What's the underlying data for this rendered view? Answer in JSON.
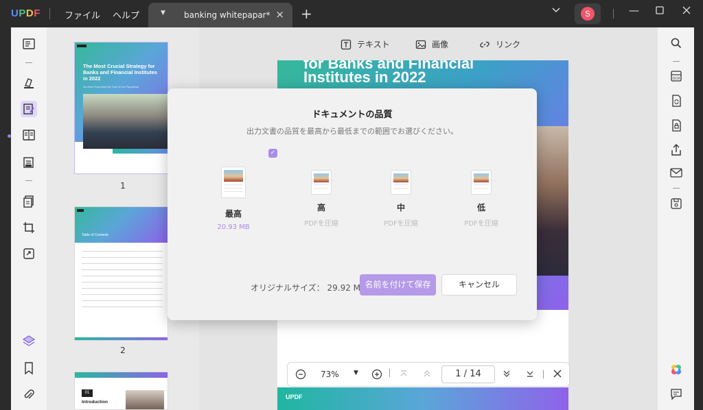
{
  "app": {
    "logo": "UPDF",
    "menu": [
      "ファイル",
      "ヘルプ"
    ]
  },
  "tab": {
    "title": "banking whitepapar*",
    "close": "×",
    "add": "+"
  },
  "user": {
    "initial": "S"
  },
  "window": {
    "minimize": "—",
    "maximize": "☐",
    "close": "✕",
    "dropdown": "⌄"
  },
  "toolbar": {
    "text_label": "テキスト",
    "image_label": "画像",
    "link_label": "リンク"
  },
  "thumbnails": [
    {
      "page": "1",
      "title": "The Most Crucial Strategy for Banks and Financial Institutes in 2022",
      "subtitle": "No More Expensive By Time to Go Paperless!"
    },
    {
      "page": "2",
      "title": "Table of Contents"
    },
    {
      "page": "3",
      "badge": "01",
      "title": "Introduction"
    }
  ],
  "document": {
    "hero_line1": "for Banks and Financial",
    "hero_line2": "Institutes in 2022",
    "footer_logo": "UPDF"
  },
  "zoom": {
    "value": "73%",
    "current_page": "1",
    "separator": "/",
    "total_pages": "14"
  },
  "dialog": {
    "title": "ドキュメントの品質",
    "subtitle": "出力文書の品質を最高から最低までの範囲でお選びください。",
    "options": [
      {
        "label": "最高",
        "note": "20.93 MB",
        "selected": true
      },
      {
        "label": "高",
        "note": "PDFを圧縮",
        "selected": false
      },
      {
        "label": "中",
        "note": "PDFを圧縮",
        "selected": false
      },
      {
        "label": "低",
        "note": "PDFを圧縮",
        "selected": false
      }
    ],
    "original_size_label": "オリジナルサイズ：",
    "original_size_value": "29.92 MB",
    "save_button": "名前を付けて保存",
    "cancel_button": "キャンセル"
  },
  "colors": {
    "accent": "#b49ae8",
    "check": "#a98de8",
    "avatar": "#f0556a",
    "titlebar": "#2b2b2b"
  }
}
